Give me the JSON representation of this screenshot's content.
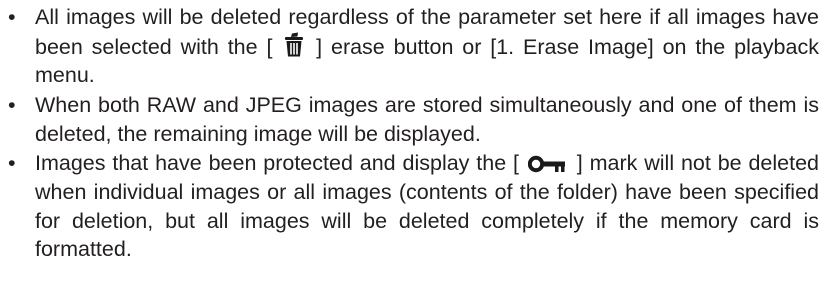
{
  "notes": [
    {
      "bullet": "•",
      "text_before_icon": "All images will be deleted regardless of the parameter set here if all images have been selected with the [",
      "icon": "trash-erase-icon",
      "text_after_icon": "] erase button or [1. Erase Image] on the playback menu."
    },
    {
      "bullet": "•",
      "text": "When both RAW and JPEG images are stored simultaneously and one of them is deleted, the remaining image will be displayed."
    },
    {
      "bullet": "•",
      "text_before_icon": "Images that have been protected and display the [",
      "icon": "key-protect-icon",
      "text_after_icon": "] mark will not be deleted when individual images or all images (contents of the folder) have been specified for deletion, but all images will be deleted completely if the memory card is formatted."
    }
  ],
  "colors": {
    "text": "#231f20",
    "icon": "#1a1a1a"
  }
}
